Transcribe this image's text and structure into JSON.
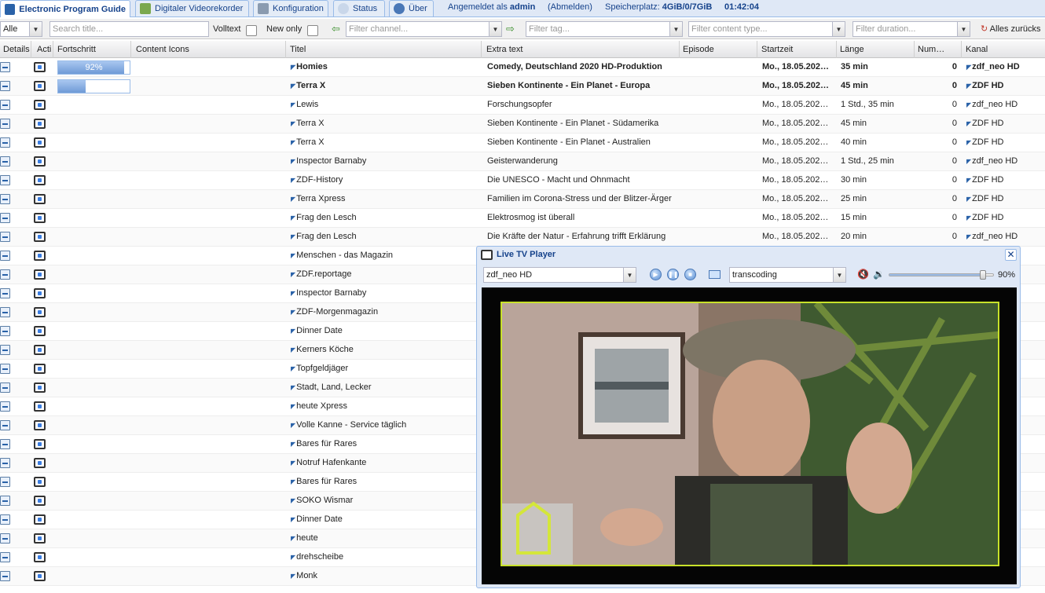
{
  "tabs": [
    {
      "label": "Electronic Program Guide",
      "icon": "epg-icon"
    },
    {
      "label": "Digitaler Videorekorder",
      "icon": "recorder-icon"
    },
    {
      "label": "Konfiguration",
      "icon": "wrench-icon"
    },
    {
      "label": "Status",
      "icon": "eye-icon"
    },
    {
      "label": "Über",
      "icon": "info-icon"
    }
  ],
  "header": {
    "logged_in_prefix": "Angemeldet als",
    "username": "admin",
    "logout": "(Abmelden)",
    "storage_label": "Speicherplatz:",
    "storage_value": "4GiB/0/7GiB",
    "time": "01:42:04"
  },
  "filters": {
    "scope": "Alle",
    "title_placeholder": "Search title...",
    "fulltext_label": "Volltext",
    "new_only_label": "New only",
    "channel_placeholder": "Filter channel...",
    "tag_placeholder": "Filter tag...",
    "content_type_placeholder": "Filter content type...",
    "duration_placeholder": "Filter duration...",
    "reset_label": "Alles zurücks"
  },
  "columns": {
    "details": "Details",
    "action": "Acti",
    "progress": "Fortschritt",
    "icons": "Content Icons",
    "title": "Titel",
    "extra": "Extra text",
    "episode": "Episode",
    "start": "Startzeit",
    "duration": "Länge",
    "number": "Num…",
    "channel": "Kanal"
  },
  "rows": [
    {
      "progress": 92,
      "progress_label": "92%",
      "icon": "🎲",
      "title": "Homies",
      "extra": "Comedy, Deutschland 2020 HD-Produktion",
      "start": "Mo., 18.05.202…",
      "duration": "35 min",
      "number": "0",
      "channel": "zdf_neo HD",
      "bold": true
    },
    {
      "progress": 38,
      "progress_label": "38%",
      "icon": "🎭",
      "title": "Terra X",
      "extra": "Sieben Kontinente - Ein Planet - Europa",
      "start": "Mo., 18.05.202…",
      "duration": "45 min",
      "number": "0",
      "channel": "ZDF HD",
      "bold": true
    },
    {
      "icon": "📺",
      "title": "Lewis",
      "extra": "Forschungsopfer",
      "start": "Mo., 18.05.202…",
      "duration": "1 Std., 35 min",
      "number": "0",
      "channel": "zdf_neo HD"
    },
    {
      "icon": "🎭",
      "title": "Terra X",
      "extra": "Sieben Kontinente - Ein Planet - Südamerika",
      "start": "Mo., 18.05.202…",
      "duration": "45 min",
      "number": "0",
      "channel": "ZDF HD"
    },
    {
      "icon": "🎭",
      "title": "Terra X",
      "extra": "Sieben Kontinente - Ein Planet - Australien",
      "start": "Mo., 18.05.202…",
      "duration": "40 min",
      "number": "0",
      "channel": "ZDF HD"
    },
    {
      "icon": "📺",
      "title": "Inspector Barnaby",
      "extra": "Geisterwanderung",
      "start": "Mo., 18.05.202…",
      "duration": "1 Std., 25 min",
      "number": "0",
      "channel": "zdf_neo HD"
    },
    {
      "icon": "🎭",
      "title": "ZDF-History",
      "extra": "Die UNESCO - Macht und Ohnmacht",
      "start": "Mo., 18.05.202…",
      "duration": "30 min",
      "number": "0",
      "channel": "ZDF HD"
    },
    {
      "icon": "📰",
      "title": "Terra Xpress",
      "extra": "Familien im Corona-Stress und der Blitzer-Ärger",
      "start": "Mo., 18.05.202…",
      "duration": "25 min",
      "number": "0",
      "channel": "ZDF HD"
    },
    {
      "icon": "📰",
      "title": "Frag den Lesch",
      "extra": "Elektrosmog ist überall",
      "start": "Mo., 18.05.202…",
      "duration": "15 min",
      "number": "0",
      "channel": "ZDF HD"
    },
    {
      "icon": "📰",
      "title": "Frag den Lesch",
      "extra": "Die Kräfte der Natur - Erfahrung trifft Erklärung",
      "start": "Mo., 18.05.202…",
      "duration": "20 min",
      "number": "0",
      "channel": "zdf_neo HD"
    },
    {
      "icon": "📰",
      "title": "Menschen - das Magazin"
    },
    {
      "icon": "📰",
      "title": "ZDF.reportage"
    },
    {
      "icon": "📺",
      "title": "Inspector Barnaby"
    },
    {
      "icon": "🗞",
      "title": "ZDF-Morgenmagazin"
    },
    {
      "icon": "🎲",
      "title": "Dinner Date"
    },
    {
      "icon": "🎲",
      "title": "Kerners Köche"
    },
    {
      "icon": "🎲",
      "title": "Topfgeldjäger"
    },
    {
      "icon": "🎲",
      "title": "Stadt, Land, Lecker"
    },
    {
      "icon": "🗞",
      "title": "heute Xpress"
    },
    {
      "icon": "📰",
      "title": "Volle Kanne - Service täglich"
    },
    {
      "icon": "🎲",
      "title": "Bares für Rares"
    },
    {
      "icon": "📺🚗",
      "title": "Notruf Hafenkante"
    },
    {
      "icon": "🎲",
      "title": "Bares für Rares"
    },
    {
      "icon": "📺🕵",
      "title": "SOKO Wismar"
    },
    {
      "icon": "🎲",
      "title": "Dinner Date"
    },
    {
      "icon": "🗞",
      "title": "heute"
    },
    {
      "icon": "📰",
      "title": "drehscheibe"
    },
    {
      "icon": "📺🕵",
      "title": "Monk"
    }
  ],
  "player": {
    "title": "Live TV Player",
    "channel": "zdf_neo HD",
    "profile": "transcoding",
    "volume": 90,
    "volume_label": "90%"
  },
  "colors": {
    "accent": "#15428b",
    "progress": "#6f9ad6",
    "video_border": "#c8e12a"
  }
}
